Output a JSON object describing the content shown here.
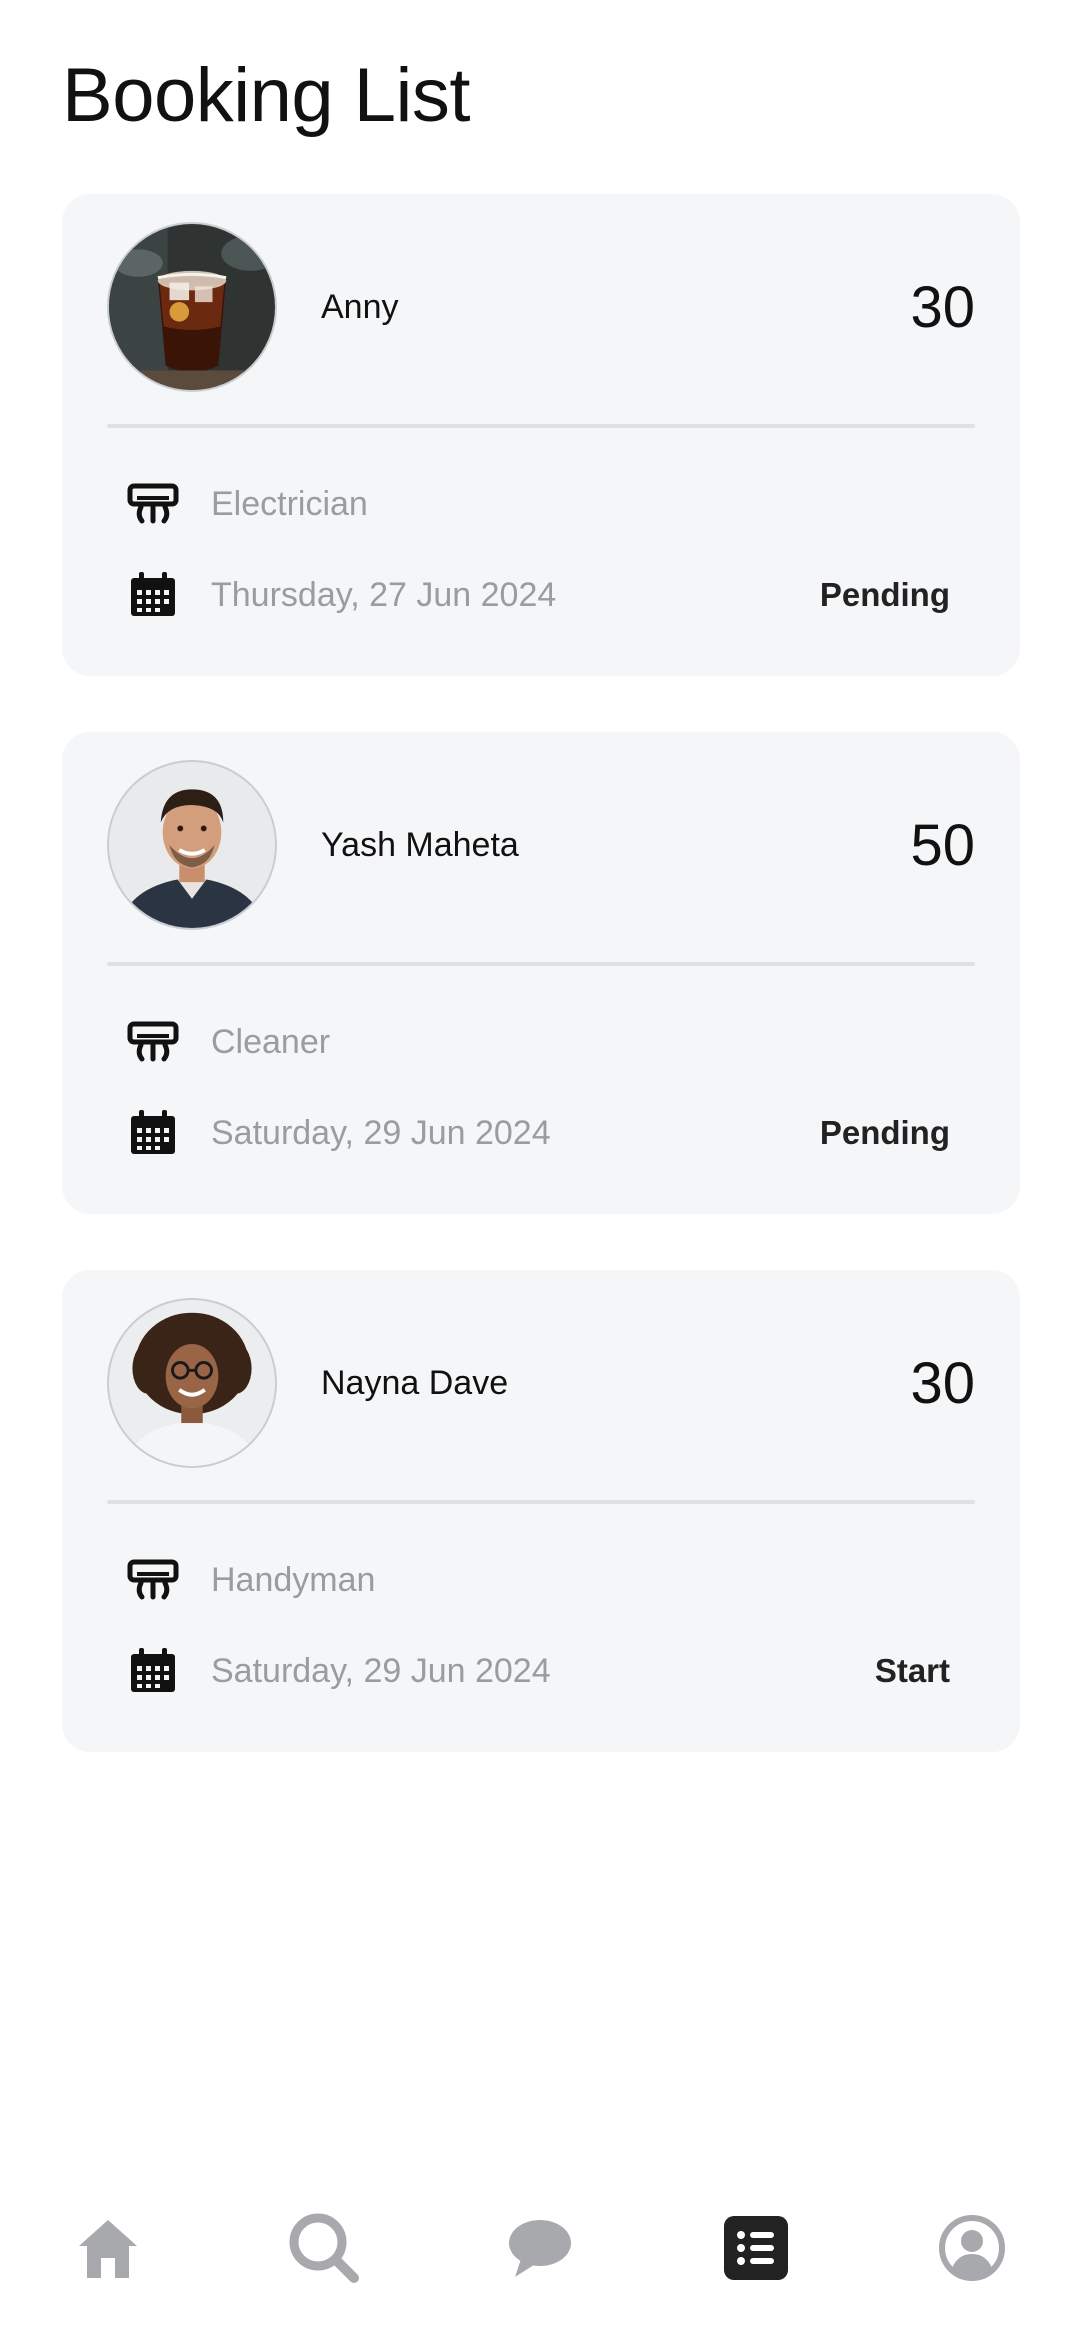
{
  "page": {
    "title": "Booking List"
  },
  "bookings": [
    {
      "name": "Anny",
      "price": "30",
      "service": "Electrician",
      "date": "Thursday, 27 Jun 2024",
      "status": "Pending",
      "avatar": "drink-photo"
    },
    {
      "name": "Yash Maheta",
      "price": "50",
      "service": "Cleaner",
      "date": "Saturday, 29 Jun 2024",
      "status": "Pending",
      "avatar": "man-portrait"
    },
    {
      "name": "Nayna Dave",
      "price": "30",
      "service": "Handyman",
      "date": "Saturday, 29 Jun 2024",
      "status": "Start",
      "avatar": "woman-portrait"
    }
  ],
  "nav": {
    "items": [
      {
        "icon": "home-icon",
        "active": false
      },
      {
        "icon": "search-icon",
        "active": false
      },
      {
        "icon": "chat-icon",
        "active": false
      },
      {
        "icon": "list-icon",
        "active": true
      },
      {
        "icon": "profile-icon",
        "active": false
      }
    ],
    "colors": {
      "active": "#222222",
      "inactive": "#a8a9ad"
    }
  }
}
